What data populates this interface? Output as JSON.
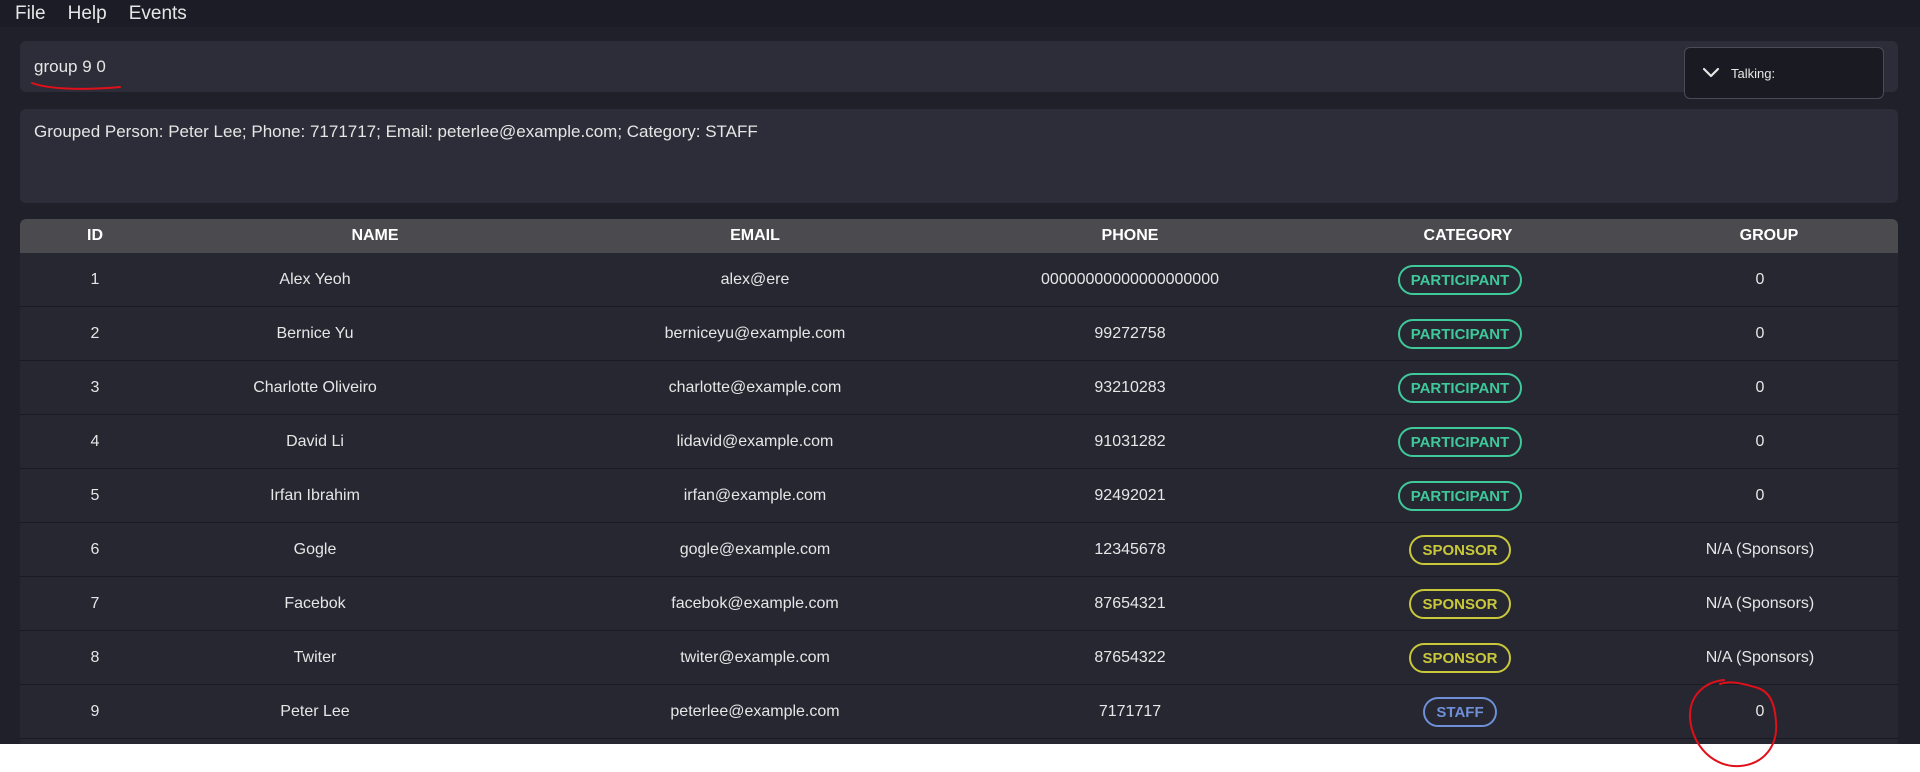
{
  "menu": [
    {
      "label": "File"
    },
    {
      "label": "Help"
    },
    {
      "label": "Events"
    }
  ],
  "command": {
    "value": "group 9 0"
  },
  "talking": {
    "label": "Talking:"
  },
  "result": {
    "text": "Grouped Person: Peter Lee; Phone: 7171717; Email: peterlee@example.com; Category: STAFF"
  },
  "table": {
    "headers": {
      "id": "ID",
      "name": "NAME",
      "email": "EMAIL",
      "phone": "PHONE",
      "category": "CATEGORY",
      "group": "GROUP"
    },
    "rows": [
      {
        "id": "1",
        "name": "Alex Yeoh",
        "email": "alex@ere",
        "phone": "00000000000000000000",
        "category": "PARTICIPANT",
        "group": "0"
      },
      {
        "id": "2",
        "name": "Bernice Yu",
        "email": "berniceyu@example.com",
        "phone": "99272758",
        "category": "PARTICIPANT",
        "group": "0"
      },
      {
        "id": "3",
        "name": "Charlotte Oliveiro",
        "email": "charlotte@example.com",
        "phone": "93210283",
        "category": "PARTICIPANT",
        "group": "0"
      },
      {
        "id": "4",
        "name": "David Li",
        "email": "lidavid@example.com",
        "phone": "91031282",
        "category": "PARTICIPANT",
        "group": "0"
      },
      {
        "id": "5",
        "name": "Irfan Ibrahim",
        "email": "irfan@example.com",
        "phone": "92492021",
        "category": "PARTICIPANT",
        "group": "0"
      },
      {
        "id": "6",
        "name": "Gogle",
        "email": "gogle@example.com",
        "phone": "12345678",
        "category": "SPONSOR",
        "group": "N/A (Sponsors)"
      },
      {
        "id": "7",
        "name": "Facebok",
        "email": "facebok@example.com",
        "phone": "87654321",
        "category": "SPONSOR",
        "group": "N/A (Sponsors)"
      },
      {
        "id": "8",
        "name": "Twiter",
        "email": "twiter@example.com",
        "phone": "87654322",
        "category": "SPONSOR",
        "group": "N/A (Sponsors)"
      },
      {
        "id": "9",
        "name": "Peter Lee",
        "email": "peterlee@example.com",
        "phone": "7171717",
        "category": "STAFF",
        "group": "0"
      }
    ]
  },
  "colors": {
    "participant": "#3fc89a",
    "sponsor": "#c8c83a",
    "staff": "#6f8fd8",
    "annotation": "#e0101a"
  },
  "icons": {
    "talking_toggle": "chevron-down-icon"
  }
}
